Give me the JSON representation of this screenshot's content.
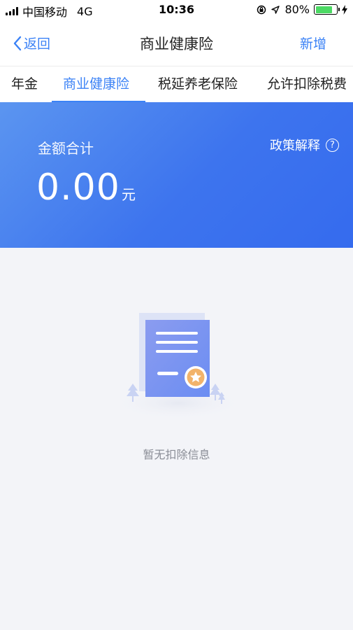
{
  "status_bar": {
    "carrier": "中国移动",
    "network": "4G",
    "time": "10:36",
    "battery": "80%",
    "battery_level": 0.8
  },
  "nav": {
    "back_label": "返回",
    "title": "商业健康险",
    "add_label": "新增"
  },
  "tabs": [
    {
      "label": "年金",
      "active": false
    },
    {
      "label": "商业健康险",
      "active": true
    },
    {
      "label": "税延养老保险",
      "active": false
    },
    {
      "label": "允许扣除税费",
      "active": false
    }
  ],
  "summary": {
    "label": "金额合计",
    "amount": "0.00",
    "unit": "元",
    "policy_label": "政策解释",
    "help_icon": "?"
  },
  "empty": {
    "message": "暂无扣除信息"
  },
  "colors": {
    "accent": "#3b82f6",
    "banner_start": "#5b95f0",
    "banner_end": "#356bee",
    "battery": "#4cd964"
  }
}
